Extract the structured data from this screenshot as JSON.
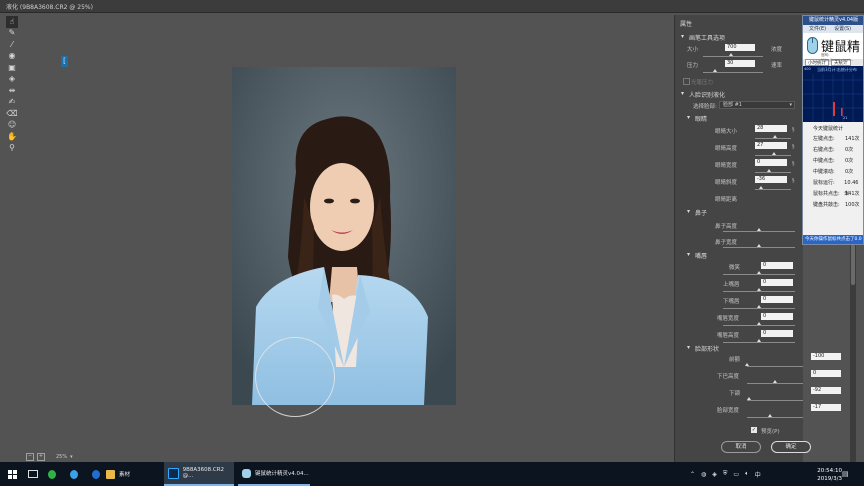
{
  "window": {
    "title": "液化 (9B8A3608.CR2 @ 25%)"
  },
  "tools": [
    {
      "icon": "warp-icon",
      "glyph": "☝"
    },
    {
      "icon": "reconstruct-brush-icon",
      "glyph": "✎"
    },
    {
      "icon": "smooth-brush-icon",
      "glyph": "⁄"
    },
    {
      "icon": "twirl-icon",
      "glyph": "◉"
    },
    {
      "icon": "pucker-icon",
      "glyph": "▣"
    },
    {
      "icon": "bloat-icon",
      "glyph": "◈"
    },
    {
      "icon": "push-left-icon",
      "glyph": "⇹"
    },
    {
      "icon": "freeze-mask-icon",
      "glyph": "✍"
    },
    {
      "icon": "thaw-mask-icon",
      "glyph": "⌫"
    },
    {
      "icon": "face-tool-icon",
      "glyph": "☺"
    },
    {
      "icon": "hand-icon",
      "glyph": "✋"
    },
    {
      "icon": "zoom-icon",
      "glyph": "⚲"
    }
  ],
  "canvas": {
    "marker": "["
  },
  "zoom": {
    "value": "25%",
    "minus": "−",
    "plus": "+"
  },
  "panel": {
    "title": "属性",
    "brush_section": "画笔工具选项",
    "brush": [
      {
        "label": "大小",
        "value": "700"
      },
      {
        "label": "浓度",
        "value": ""
      },
      {
        "label": "压力",
        "value": "30"
      },
      {
        "label": "速率",
        "value": ""
      }
    ],
    "stylus": "光笔压力",
    "face_section": "人脸识别液化",
    "select_face_label": "选择脸部:",
    "select_face_value": "脸部 #1",
    "eye_section": "眼睛",
    "eye": [
      {
        "label": "眼睛大小",
        "value": "28"
      },
      {
        "label": "眼睛高度",
        "value": "27"
      },
      {
        "label": "眼睛宽度",
        "value": "0"
      },
      {
        "label": "眼睛斜度",
        "value": "-36"
      },
      {
        "label": "眼睛距离",
        "value": ""
      }
    ],
    "nose_section": "鼻子",
    "nose": [
      {
        "label": "鼻子高度"
      },
      {
        "label": "鼻子宽度"
      }
    ],
    "mouth_section": "嘴唇",
    "mouth": [
      {
        "label": "微笑",
        "value": "0"
      },
      {
        "label": "上嘴唇",
        "value": "0"
      },
      {
        "label": "下嘴唇",
        "value": "0"
      },
      {
        "label": "嘴唇宽度",
        "value": "0"
      },
      {
        "label": "嘴唇高度",
        "value": "0"
      }
    ],
    "shape_section": "脸部形状",
    "shape": [
      {
        "label": "前额",
        "value": "-100"
      },
      {
        "label": "下巴高度",
        "value": "0"
      },
      {
        "label": "下颌",
        "value": "-92"
      },
      {
        "label": "脸部宽度",
        "value": "-17"
      }
    ],
    "preview": "预览(P)",
    "cancel": "取消",
    "ok": "确定"
  },
  "keystats": {
    "title": "键鼠统计精灵v4.04版",
    "menu": [
      "文件(E)",
      "设置(S)"
    ],
    "brand": "键鼠精",
    "url": "官网：http://www.ciwei...",
    "tabs": [
      "小时统计",
      "天统计"
    ],
    "graph_label": "当前3月计:击统计分布",
    "graph_ticks": [
      "400",
      "21"
    ],
    "today": "今天键鼠统计",
    "stats": [
      {
        "k": "左键点击:",
        "v": "141次"
      },
      {
        "k": "右键点击:",
        "v": "0次"
      },
      {
        "k": "中键点击:",
        "v": "0次"
      },
      {
        "k": "中键滚动:",
        "v": "0次"
      },
      {
        "k": "鼠标运行:",
        "v": "10.46米"
      },
      {
        "k": "鼠标共点击:",
        "v": "141次"
      },
      {
        "k": "键盘共敲击:",
        "v": "100次"
      }
    ],
    "footer": "今天你操作鼠标共点击了0.0"
  },
  "taskbar": {
    "items": [
      {
        "label": "素材"
      },
      {
        "label": "9B8A3608.CR2 @..."
      },
      {
        "label": "键鼠统计精灵v4.04..."
      }
    ],
    "time": "20:54:10",
    "date": "2019/3/3"
  }
}
